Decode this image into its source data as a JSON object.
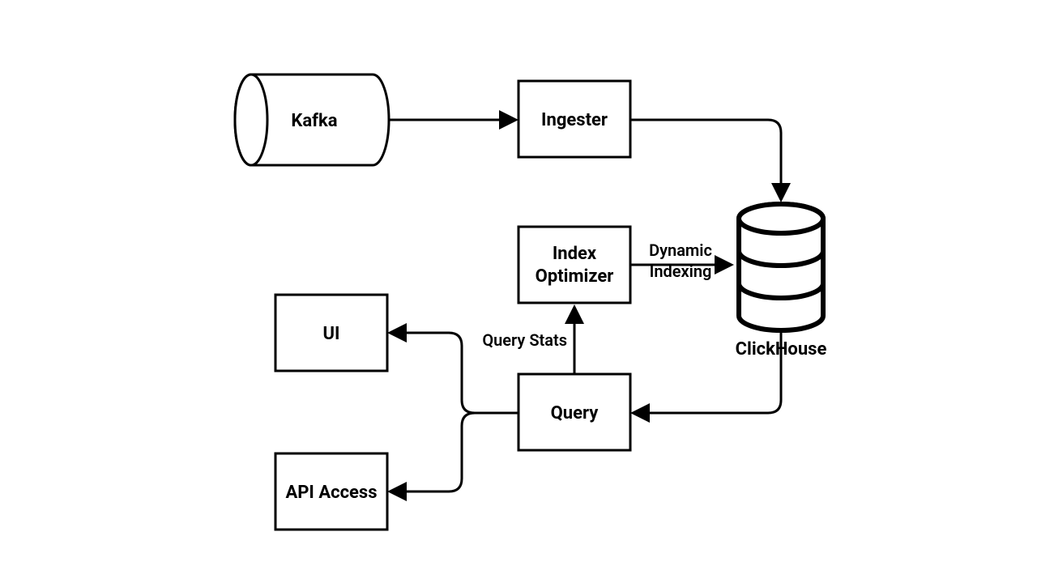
{
  "diagram": {
    "nodes": {
      "kafka": {
        "label": "Kafka",
        "shape": "cylinder-h"
      },
      "ingester": {
        "label": "Ingester",
        "shape": "rect"
      },
      "clickhouse": {
        "label": "ClickHouse",
        "shape": "db-stack"
      },
      "indexopt": {
        "label1": "Index",
        "label2": "Optimizer",
        "shape": "rect"
      },
      "query": {
        "label": "Query",
        "shape": "rect"
      },
      "ui": {
        "label": "UI",
        "shape": "rect"
      },
      "api": {
        "label": "API Access",
        "shape": "rect"
      }
    },
    "edges": {
      "kafka_ingester": {
        "from": "kafka",
        "to": "ingester",
        "label": ""
      },
      "ingester_clickhouse": {
        "from": "ingester",
        "to": "clickhouse",
        "label": ""
      },
      "indexopt_clickhouse": {
        "from": "indexopt",
        "to": "clickhouse",
        "label1": "Dynamic",
        "label2": "Indexing"
      },
      "query_indexopt": {
        "from": "query",
        "to": "indexopt",
        "label": "Query Stats"
      },
      "clickhouse_query": {
        "from": "clickhouse",
        "to": "query",
        "label": ""
      },
      "query_ui": {
        "from": "query",
        "to": "ui",
        "label": ""
      },
      "query_api": {
        "from": "query",
        "to": "api",
        "label": ""
      }
    }
  }
}
